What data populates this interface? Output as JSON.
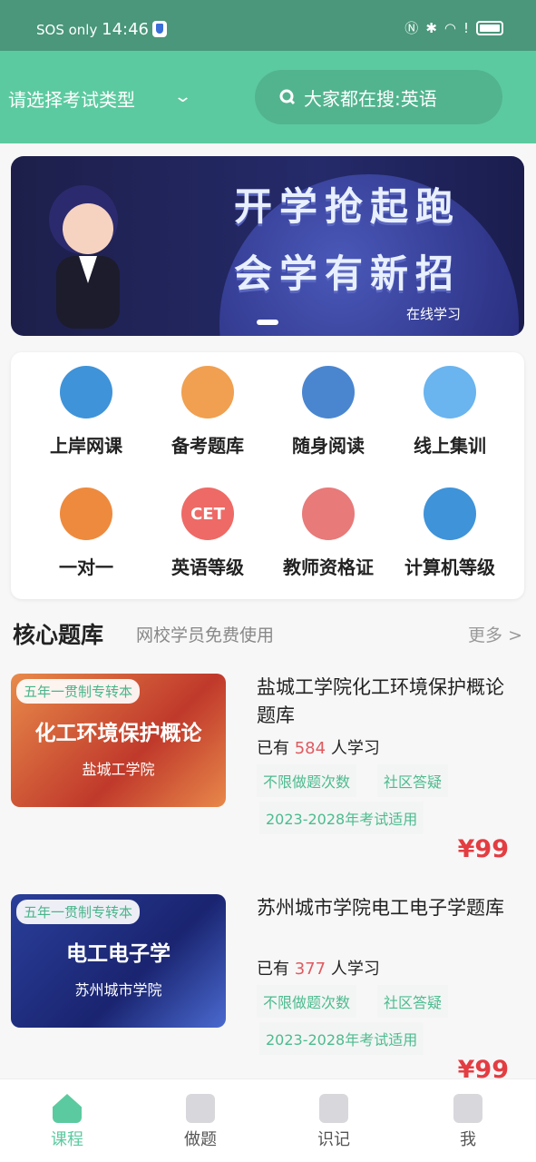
{
  "status": {
    "carrier": "SOS only",
    "time": "14:46",
    "icons": [
      "nfc-icon",
      "bluetooth-icon",
      "wifi-icon",
      "alert-icon",
      "battery-icon"
    ]
  },
  "header": {
    "exam_select": "请选择考试类型",
    "search_placeholder": "大家都在搜:英语"
  },
  "banner": {
    "line1": "开学抢起跑",
    "line2": "会学有新招",
    "sub": "在线学习"
  },
  "grid": [
    {
      "label": "上岸网课",
      "icon": "play-icon",
      "color": "#3f93d9"
    },
    {
      "label": "备考题库",
      "icon": "scroll-icon",
      "color": "#f0a050"
    },
    {
      "label": "随身阅读",
      "icon": "book-icon",
      "color": "#4a86d0"
    },
    {
      "label": "线上集训",
      "icon": "monitor-icon",
      "color": "#6ab4ef"
    },
    {
      "label": "一对一",
      "icon": "one-icon",
      "color": "#ee8a3e"
    },
    {
      "label": "英语等级",
      "icon": "cet-icon",
      "color": "#ee6a66",
      "text": "CET"
    },
    {
      "label": "教师资格证",
      "icon": "teacher-icon",
      "color": "#e87a7a"
    },
    {
      "label": "计算机等级",
      "icon": "computer-icon",
      "color": "#3f93d9"
    }
  ],
  "section": {
    "title": "核心题库",
    "subtitle": "网校学员免费使用",
    "more": "更多 >"
  },
  "courses": [
    {
      "badge": "五年一贯制专转本",
      "cover_title": "化工环境保护概论",
      "cover_school": "盐城工学院",
      "name": "盐城工学院化工环境保护概论题库",
      "prefix": "已有",
      "count": "584",
      "suffix": "人学习",
      "tags": [
        "不限做题次数",
        "社区答疑",
        "2023-2028年考试适用"
      ],
      "price": "¥99"
    },
    {
      "badge": "五年一贯制专转本",
      "cover_title": "电工电子学",
      "cover_school": "苏州城市学院",
      "name": "苏州城市学院电工电子学题库",
      "prefix": "已有",
      "count": "377",
      "suffix": "人学习",
      "tags": [
        "不限做题次数",
        "社区答疑",
        "2023-2028年考试适用"
      ],
      "price": "¥99"
    }
  ],
  "nav": [
    {
      "label": "课程",
      "active": true
    },
    {
      "label": "做题"
    },
    {
      "label": "识记"
    },
    {
      "label": "我"
    }
  ],
  "colors": {
    "primary": "#5ccaa0",
    "price": "#e33d42"
  }
}
